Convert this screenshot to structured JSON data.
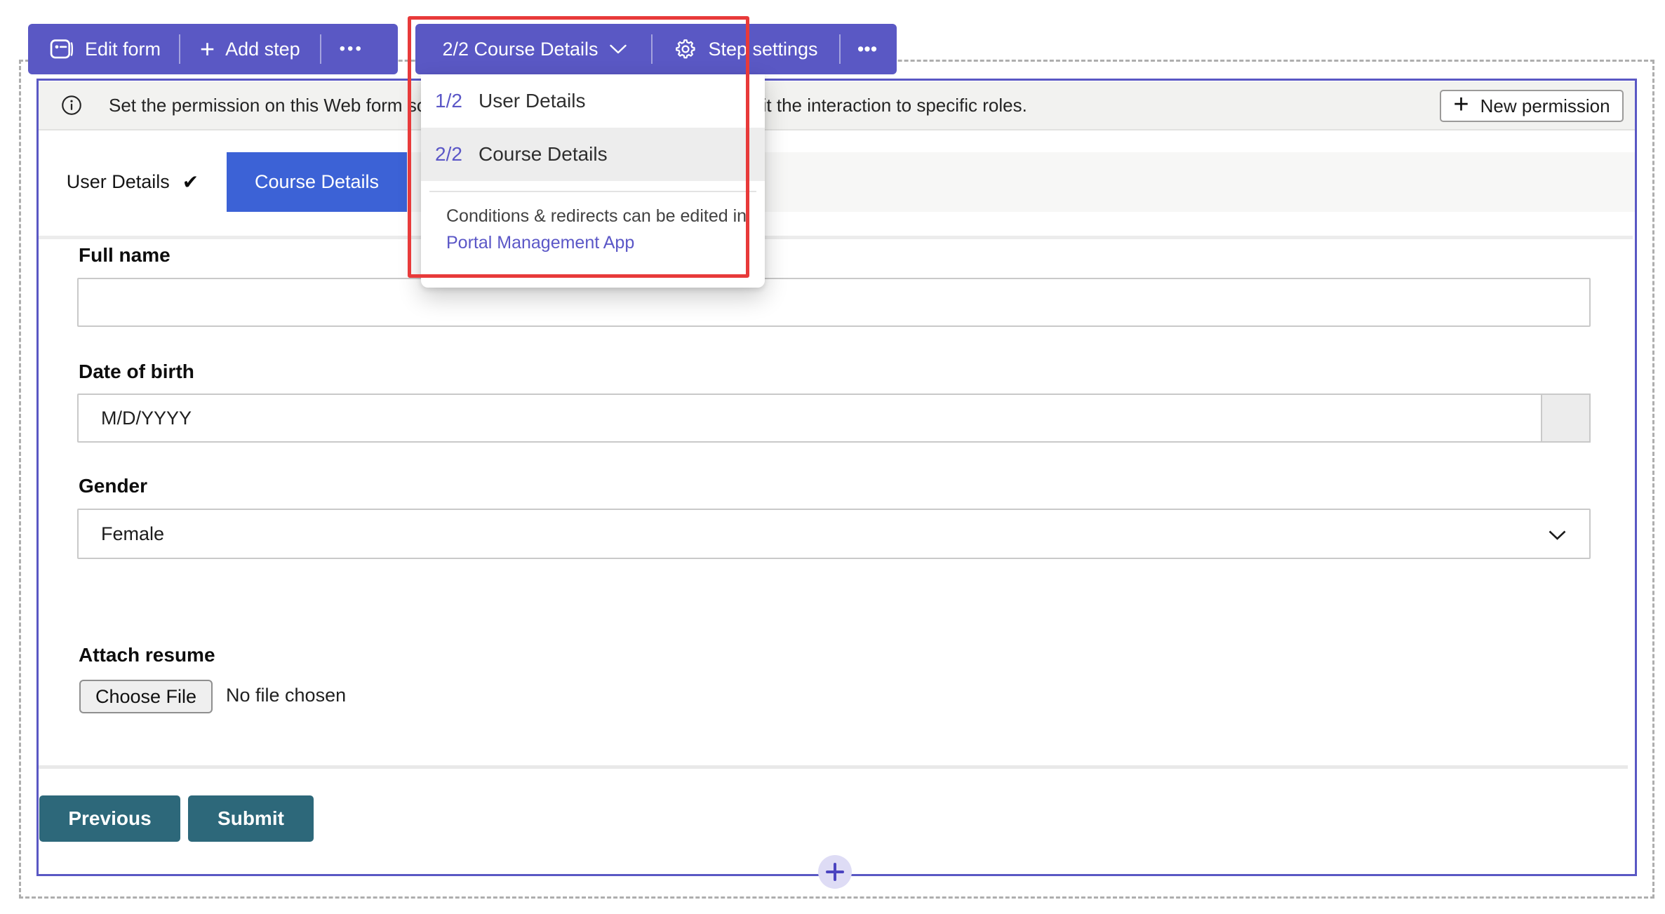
{
  "colors": {
    "accent_purple": "#5a58c4",
    "active_tab_blue": "#3c62d6",
    "highlight_red": "#e83a3a",
    "action_button_teal": "#2d687a",
    "link_purple": "#5b57c7"
  },
  "toolbar": {
    "edit_form_label": "Edit form",
    "add_step_label": "Add step",
    "more_glyph": "•••",
    "step_selector_label": "2/2 Course Details",
    "step_settings_label": "Step settings"
  },
  "step_menu": {
    "items": [
      {
        "number": "1/2",
        "label": "User Details",
        "highlighted": false
      },
      {
        "number": "2/2",
        "label": "Course Details",
        "highlighted": true
      }
    ],
    "note_text": "Conditions & redirects can be edited in",
    "note_link_label": "Portal Management App"
  },
  "permission_banner": {
    "message": "Set the permission on this Web form so it can be interacted with by anyone or limit the interaction to specific roles.",
    "new_permission_label": "New permission"
  },
  "step_tabs": {
    "user_details_label": "User Details",
    "user_details_check": "✔",
    "course_details_label": "Course Details"
  },
  "form": {
    "fields": [
      {
        "label": "Full name",
        "type": "text",
        "value": ""
      },
      {
        "label": "Date of birth",
        "type": "date",
        "placeholder": "M/D/YYYY"
      },
      {
        "label": "Gender",
        "type": "select",
        "value": "Female"
      },
      {
        "label": "Attach resume",
        "type": "file",
        "button_label": "Choose File",
        "status_text": "No file chosen"
      }
    ],
    "previous_label": "Previous",
    "submit_label": "Submit"
  }
}
